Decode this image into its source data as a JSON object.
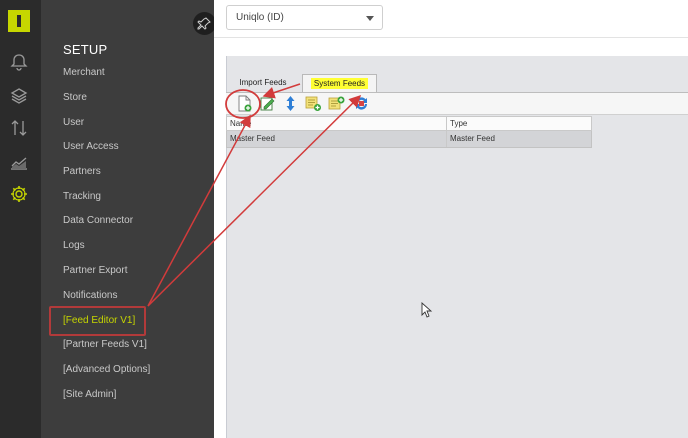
{
  "menu": {
    "title": "SETUP",
    "items": [
      {
        "label": "Merchant"
      },
      {
        "label": "Store"
      },
      {
        "label": "User"
      },
      {
        "label": "User Access"
      },
      {
        "label": "Partners"
      },
      {
        "label": "Tracking"
      },
      {
        "label": "Data Connector"
      },
      {
        "label": "Logs"
      },
      {
        "label": "Partner Export"
      },
      {
        "label": "Notifications"
      },
      {
        "label": "[Feed Editor V1]"
      },
      {
        "label": "[Partner Feeds V1]"
      },
      {
        "label": "[Advanced Options]"
      },
      {
        "label": "[Site Admin]"
      }
    ],
    "active_item": "[Feed Editor V1]"
  },
  "rail": {
    "icons": [
      "bell-icon",
      "layers-icon",
      "transfer-icon",
      "chart-icon",
      "gear-icon"
    ]
  },
  "store_select": {
    "value": "Uniqlo (ID)"
  },
  "tabs": [
    {
      "label": "Import Feeds",
      "selected": false
    },
    {
      "label": "System Feeds",
      "selected": true
    }
  ],
  "toolbar": {
    "buttons": [
      "new-document-icon",
      "edit-icon",
      "sort-icon",
      "add-item-icon",
      "add-list-icon",
      "refresh-icon"
    ]
  },
  "grid": {
    "columns": [
      "Name",
      "Type"
    ],
    "rows": [
      {
        "name": "Master Feed",
        "type": "Master Feed"
      }
    ]
  },
  "colors": {
    "accent": "#c6d600",
    "annotation": "#b23a3a",
    "highlight": "#ffff33"
  }
}
